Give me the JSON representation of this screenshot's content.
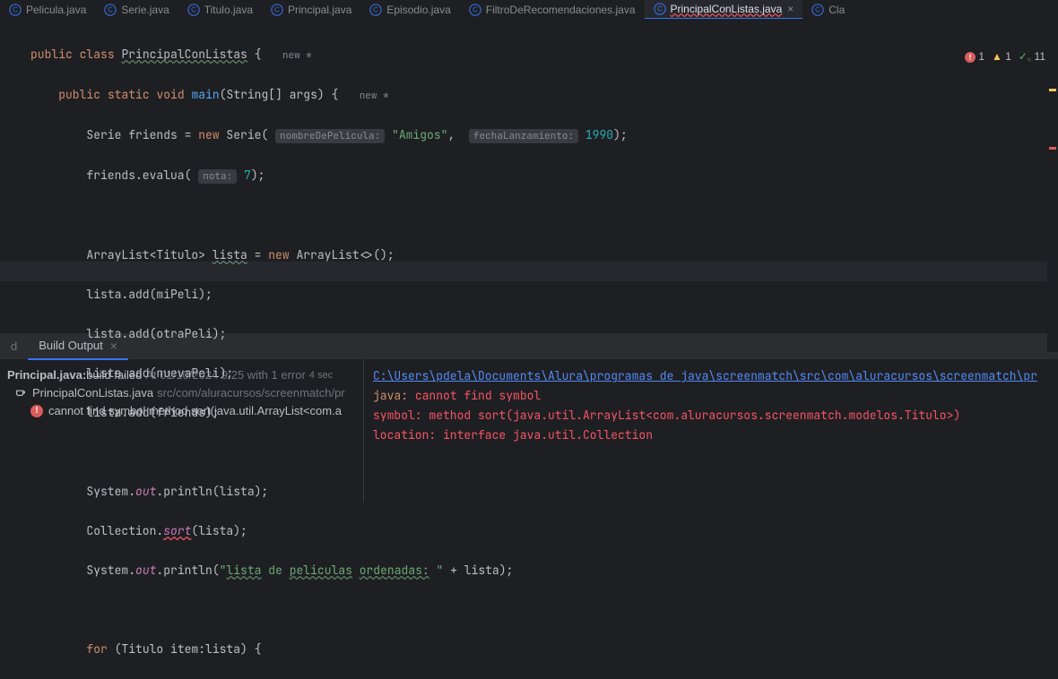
{
  "tabs": [
    {
      "label": "Pelicula.java"
    },
    {
      "label": "Serie.java"
    },
    {
      "label": "Titulo.java"
    },
    {
      "label": "Principal.java"
    },
    {
      "label": "Episodio.java"
    },
    {
      "label": "FiltroDeRecomendaciones.java"
    },
    {
      "label": "PrincipalConListas.java"
    },
    {
      "label": "Cla"
    }
  ],
  "status": {
    "errors": "1",
    "warnings": "1",
    "hints": "11"
  },
  "code": {
    "kw_public": "public",
    "kw_class": "class",
    "cls": "PrincipalConListas",
    "brace": "{",
    "annot_new": "new *",
    "kw_static": "static",
    "kw_void": "void",
    "m_main": "main",
    "main_sig": "(String[] args) {",
    "l3a": "Serie friends = ",
    "kw_new": "new",
    "l3b": " Serie( ",
    "hint1": "nombreDePelicula:",
    "str1": " \"Amigos\"",
    "comma": ",  ",
    "hint2": "fechaLanzamiento:",
    "num1": " 1990",
    "l3e": ");",
    "l4a": "friends.evalua( ",
    "hint3": "nota:",
    "num2": " 7",
    "l4b": ");",
    "l6": "ArrayList<Titulo> ",
    "lista": "lista",
    "l6b": " = ",
    "l6c": " ArrayList<>();",
    "l7": "lista.add(miPeli);",
    "l8": "lista.add(otraPeli);",
    "l9": "lista.add(nuevaPeli);",
    "l10": "lista.add(friends);",
    "l12a": "System.",
    "out": "out",
    "l12b": ".println(lista);",
    "l13a": "Collection.",
    "sort": "sort",
    "l13b": "(lista);",
    "l14a": "System.",
    "l14b": ".println(",
    "str2a": "\"",
    "w1": "lista",
    "sp": " ",
    "de": "de",
    "w2": "peliculas",
    "w3": "ordenadas",
    "colon": ":",
    "str2b": " \"",
    "l14c": " + lista);",
    "kw_for": "for",
    "l16": " (Titulo item:lista) {"
  },
  "panel": {
    "tab_d": "d",
    "tab_build": "Build Output",
    "r1a": "Principal.java:",
    "r1b": " build failed",
    "r1c": " At 01/10/2024 9:25 with 1 error",
    "r1d": " 4 sec",
    "r2a": "PrincipalConListas.java",
    "r2b": " src/com/aluracursos/screenmatch/pr",
    "r3": "cannot find symbol method sort(java.util.ArrayList<com.a"
  },
  "console": {
    "path": "C:\\Users\\pdela\\Documents\\Alura\\programas de java\\screenmatch\\src\\com\\aluracursos\\screenmatch\\pr",
    "l2a": "java: ",
    "l2b": "cannot find symbol",
    "l3": "  symbol:   method sort(java.util.ArrayList<com.aluracursos.screenmatch.modelos.Titulo>)",
    "l4": "  location: interface java.util.Collection"
  }
}
